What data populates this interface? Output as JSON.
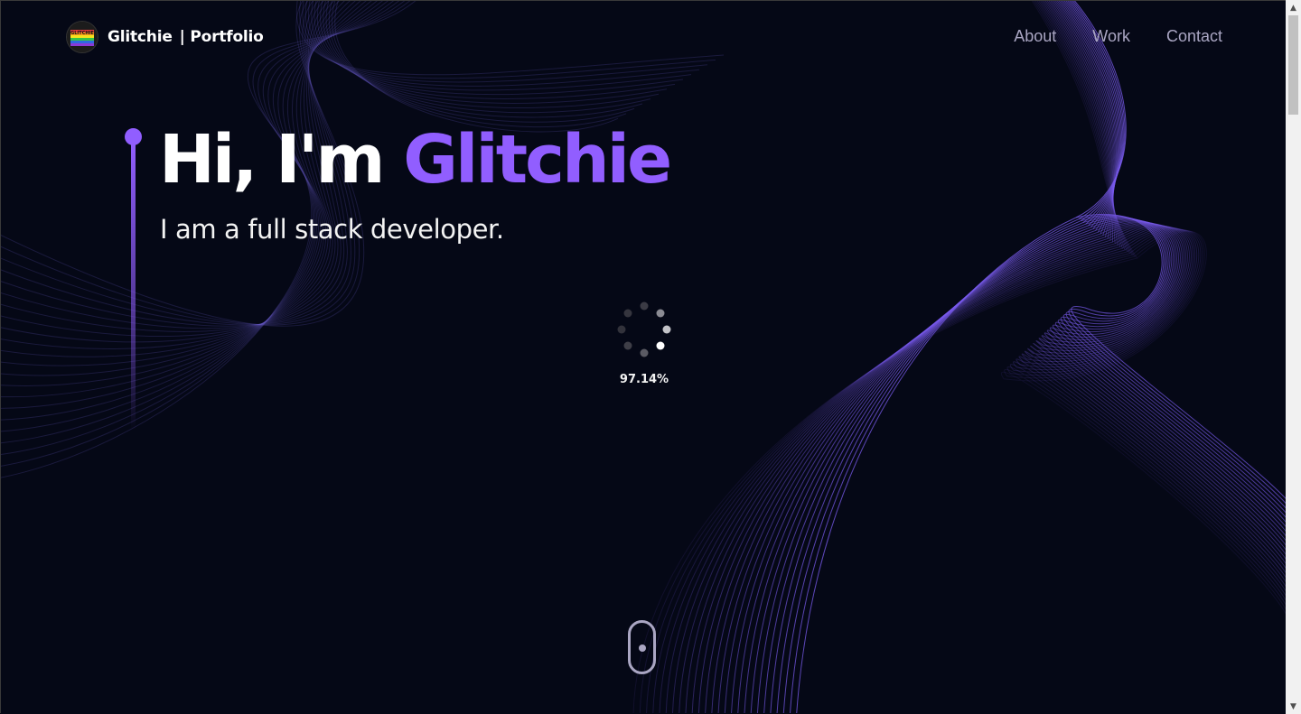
{
  "header": {
    "brand_name": "Glitchie",
    "brand_suffix": "| Portfolio",
    "logo_text": "GLITCHIE",
    "logo_icon": "rainbow-logo-icon",
    "nav": [
      {
        "label": "About"
      },
      {
        "label": "Work"
      },
      {
        "label": "Contact"
      }
    ]
  },
  "hero": {
    "greeting": "Hi, I'm ",
    "name": "Glitchie",
    "subtitle": "I am a full stack developer."
  },
  "loader": {
    "progress_text": "97.14%",
    "icon": "spinner-icon"
  },
  "scroll_indicator": {
    "icon": "mouse-scroll-icon"
  },
  "colors": {
    "background": "#050816",
    "accent": "#915EFF",
    "nav_text": "#aaa6c3",
    "text": "#ffffff"
  }
}
